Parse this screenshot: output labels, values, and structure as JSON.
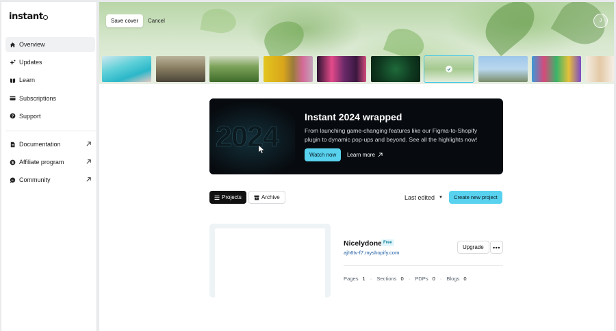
{
  "app": {
    "logo": "instant"
  },
  "sidebar": {
    "primary": [
      {
        "label": "Overview",
        "icon": "home-icon",
        "active": true
      },
      {
        "label": "Updates",
        "icon": "sparkle-icon"
      },
      {
        "label": "Learn",
        "icon": "book-icon"
      },
      {
        "label": "Subscriptions",
        "icon": "card-icon"
      },
      {
        "label": "Support",
        "icon": "help-icon"
      }
    ],
    "secondary": [
      {
        "label": "Documentation",
        "icon": "document-icon"
      },
      {
        "label": "Affiliate program",
        "icon": "dollar-icon"
      },
      {
        "label": "Community",
        "icon": "chat-icon"
      }
    ]
  },
  "cover": {
    "save_label": "Save cover",
    "cancel_label": "Cancel",
    "avatar_initial": "J",
    "selected_index": 6
  },
  "banner": {
    "year": "2024",
    "title": "Instant 2024 wrapped",
    "description": "From launching game-changing features like our Figma-to-Shopify plugin to dynamic pop-ups and beyond. See all the highlights now!",
    "watch_label": "Watch now",
    "learn_label": "Learn more"
  },
  "toolbar": {
    "projects_label": "Projects",
    "archive_label": "Archive",
    "sort_label": "Last edited",
    "create_label": "Create new project"
  },
  "project": {
    "name": "Nicelydone",
    "plan": "Free",
    "domain": "ajh6tv-f7.myshopify.com",
    "upgrade_label": "Upgrade",
    "stats": [
      {
        "label": "Pages",
        "value": "1"
      },
      {
        "label": "Sections",
        "value": "0"
      },
      {
        "label": "PDPs",
        "value": "0"
      },
      {
        "label": "Blogs",
        "value": "0"
      }
    ]
  },
  "colors": {
    "accent": "#58d2ef",
    "banner_bg": "#070b0f"
  }
}
